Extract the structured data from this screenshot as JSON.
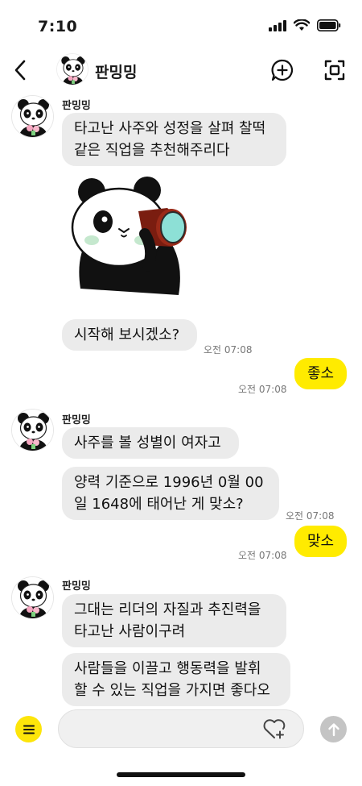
{
  "status_bar": {
    "time": "7:10"
  },
  "header": {
    "title": "판밍밍"
  },
  "colors": {
    "my_bubble": "#ffeb00",
    "bubble": "#ebebeb",
    "menu_button": "#fde50a"
  },
  "icons": [
    "chevron-left-icon",
    "add-chat-icon",
    "scan-icon",
    "menu-icon",
    "heart-plus-icon",
    "arrow-up-icon",
    "signal-icon",
    "wifi-icon",
    "battery-icon"
  ],
  "messages": {
    "group1": {
      "sender": "판밍밍",
      "bubble1": "타고난 사주와 성정을 살펴 찰떡\n같은 직업을 추천해주리다",
      "bubble2": "시작해 보시겠소?",
      "time": "오전 07:08"
    },
    "me1": {
      "text": "좋소",
      "time": "오전 07:08"
    },
    "group2": {
      "sender": "판밍밍",
      "bubble1": "사주를 볼 성별이 여자고",
      "bubble2": "양력 기준으로 1996년 0월 00\n일 1648에 태어난 게 맞소?",
      "time": "오전 07:08"
    },
    "me2": {
      "text": "맞소",
      "time": "오전 07:08"
    },
    "group3": {
      "sender": "판밍밍",
      "bubble1": "그대는 리더의 자질과 추진력을\n타고난 사람이구려",
      "bubble2": "사람들을 이끌고 행동력을 발휘\n할 수 있는 직업을 가지면 좋다오"
    }
  }
}
